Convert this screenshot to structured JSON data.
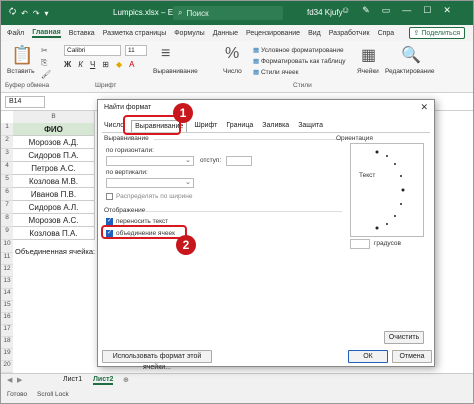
{
  "titlebar": {
    "autosave": "🗘",
    "filename": "Lumpics.xlsx",
    "app": "Excel",
    "search_placeholder": "Поиск",
    "user": "fd34 Kjufy"
  },
  "ribbon_tabs": [
    "Файл",
    "Главная",
    "Вставка",
    "Разметка страницы",
    "Формулы",
    "Данные",
    "Рецензирование",
    "Вид",
    "Разработчик",
    "Спра"
  ],
  "share_label": "Поделиться",
  "ribbon": {
    "paste_label": "Вставить",
    "font_name": "Calibri",
    "font_size": "11",
    "alignment_label": "Выравнивание",
    "number_label": "Число",
    "styles_items": [
      "Условное форматирование",
      "Форматировать как таблицу",
      "Стили ячеек"
    ],
    "cells_label": "Ячейки",
    "editing_label": "Редактирование",
    "groups": [
      "Буфер обмена",
      "Шрифт",
      "Стили"
    ]
  },
  "formula_bar": {
    "namebox": "B14"
  },
  "grid": {
    "columns": [
      "B"
    ],
    "header": "ФИО",
    "names": [
      "Морозов А.Д.",
      "Сидоров П.А.",
      "Петров А.С.",
      "Козлова М.В.",
      "Иванов П.В.",
      "Сидоров А.Л.",
      "Морозов А.С.",
      "Козлова П.А."
    ],
    "note": "Объединенная ячейка:"
  },
  "sheets": {
    "tab1": "Лист1",
    "tab2": "Лист2"
  },
  "status": {
    "ready": "Готово",
    "scroll_lock": "Scroll Lock"
  },
  "dialog": {
    "title": "Найти формат",
    "close": "✕",
    "tabs": [
      "Число",
      "Выравнивание",
      "Шрифт",
      "Граница",
      "Заливка",
      "Защита"
    ],
    "alignment_section": "Выравнивание",
    "horizontal_label": "по горизонтали:",
    "indent_label": "отступ:",
    "vertical_label": "по вертикали:",
    "distribute_label": "Распределять по ширине",
    "display_section": "Отображение",
    "wrap_text": "переносить текст",
    "merge_cells": "объединение ячеек",
    "orientation_section": "Ориентация",
    "orientation_text": "Текст",
    "degrees_label": "градусов",
    "clear_button": "Очистить",
    "use_format_button": "Использовать формат этой ячейки...",
    "ok_button": "ОК",
    "cancel_button": "Отмена"
  },
  "callouts": [
    "1",
    "2"
  ],
  "colors": {
    "excel_green": "#1f6e43",
    "header_fill": "#d6e8d4",
    "callout_red": "#c8161d",
    "highlight_red": "#d7191f"
  }
}
